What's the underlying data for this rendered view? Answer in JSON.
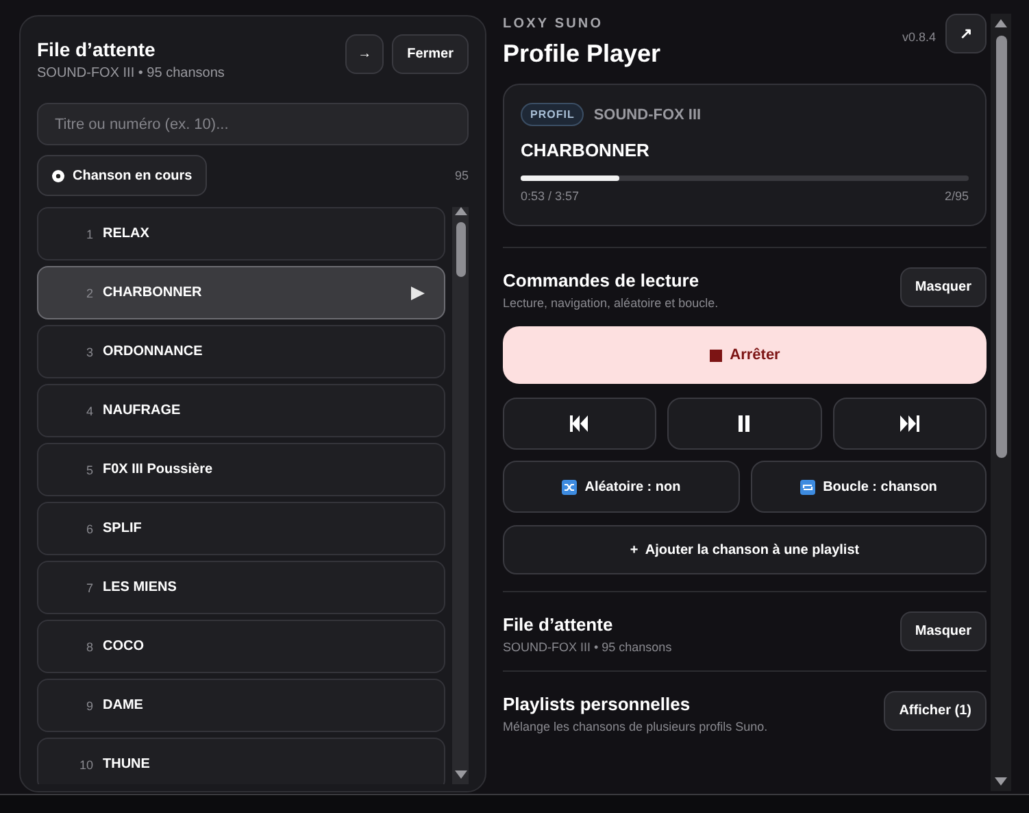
{
  "queue_panel": {
    "title": "File d’attente",
    "subtitle": "SOUND-FOX III • 95 chansons",
    "buttons": [
      {
        "kind": "arrow",
        "label": "→"
      },
      {
        "kind": "text",
        "label": "Fermer"
      }
    ],
    "search": {
      "placeholder": "Titre ou numéro (ex. 10)..."
    },
    "filter_chip": {
      "label": "Chanson en cours"
    },
    "count": "95",
    "songs": [
      {
        "number": "1",
        "title": "RELAX",
        "selected": false
      },
      {
        "number": "2",
        "title": "CHARBONNER",
        "selected": true
      },
      {
        "number": "3",
        "title": "ORDONNANCE",
        "selected": false
      },
      {
        "number": "4",
        "title": "NAUFRAGE",
        "selected": false
      },
      {
        "number": "5",
        "title": "F0X III Poussière",
        "selected": false
      },
      {
        "number": "6",
        "title": "SPLIF",
        "selected": false
      },
      {
        "number": "7",
        "title": "LES MIENS",
        "selected": false
      },
      {
        "number": "8",
        "title": "COCO",
        "selected": false
      },
      {
        "number": "9",
        "title": "DAME",
        "selected": false
      },
      {
        "number": "10",
        "title": "THUNE",
        "selected": false
      }
    ]
  },
  "player": {
    "brand": "LOXY SUNO",
    "title": "Profile Player",
    "version": "v0.8.4",
    "popout_button": "↗",
    "now_playing": {
      "badge": "PROFIL",
      "profile": "SOUND-FOX III",
      "song": "CHARBONNER",
      "level": 0.22,
      "time": "0:53 / 3:57",
      "position": "2/95"
    },
    "sections": [
      {
        "kind": "controls",
        "title": "Commandes de lecture",
        "subtitle": "Lecture, navigation, aléatoire et boucle.",
        "button": "Masquer",
        "stop_button": "Arrêter",
        "transport": [
          {
            "kind": "previous"
          },
          {
            "kind": "pause"
          },
          {
            "kind": "next"
          }
        ],
        "toggles": [
          {
            "kind": "shuffle",
            "label": "Aléatoire : non"
          },
          {
            "kind": "repeat",
            "label": "Boucle : chanson"
          }
        ],
        "add_button": {
          "icon": "+",
          "label": "Ajouter la chanson à une playlist"
        }
      },
      {
        "kind": "plain",
        "title": "File d’attente",
        "subtitle": "SOUND-FOX III • 95 chansons",
        "button": "Masquer"
      },
      {
        "kind": "plain",
        "title": "Playlists personnelles",
        "subtitle": "Mélange les chansons de plusieurs profils Suno.",
        "button": "Afficher (1)"
      }
    ]
  }
}
